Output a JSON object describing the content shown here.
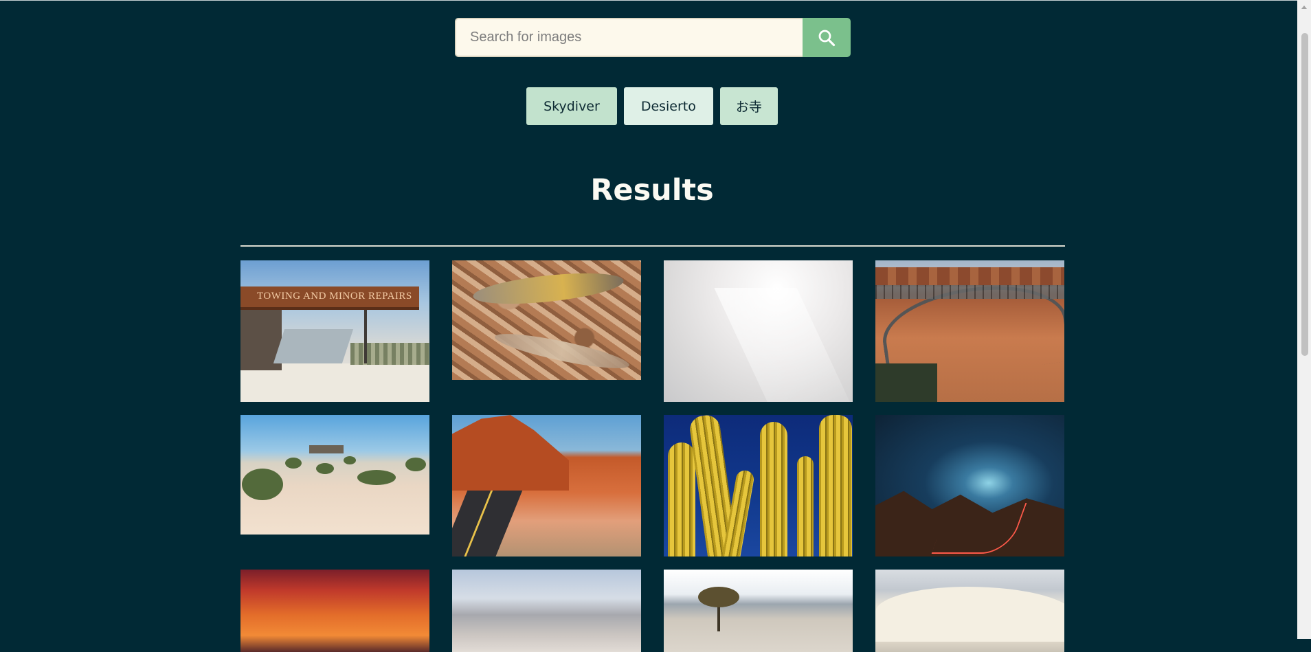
{
  "search": {
    "placeholder": "Search for images",
    "value": "",
    "button_icon": "search-icon"
  },
  "tags": [
    "Skydiver",
    "Desierto",
    "お寺"
  ],
  "results": {
    "heading": "Results",
    "images": [
      {
        "subject": "abandoned gas station",
        "sign_text": "TOWING AND MINOR REPAIRS"
      },
      {
        "subject": "lizards on rocks"
      },
      {
        "subject": "cloudy sky"
      },
      {
        "subject": "canyon bridge"
      },
      {
        "subject": "desert shrubs"
      },
      {
        "subject": "red rock road"
      },
      {
        "subject": "cacti"
      },
      {
        "subject": "night canyon light trail"
      },
      {
        "subject": "sunset sky"
      },
      {
        "subject": "desert plain"
      },
      {
        "subject": "lone tree"
      },
      {
        "subject": "sand dune"
      }
    ]
  },
  "colors": {
    "background": "#012935",
    "search_button": "#7bc08c",
    "input_background": "#fdf9ec",
    "tag_background": "#c2e2cd",
    "heading_text": "#fbfaf3"
  }
}
